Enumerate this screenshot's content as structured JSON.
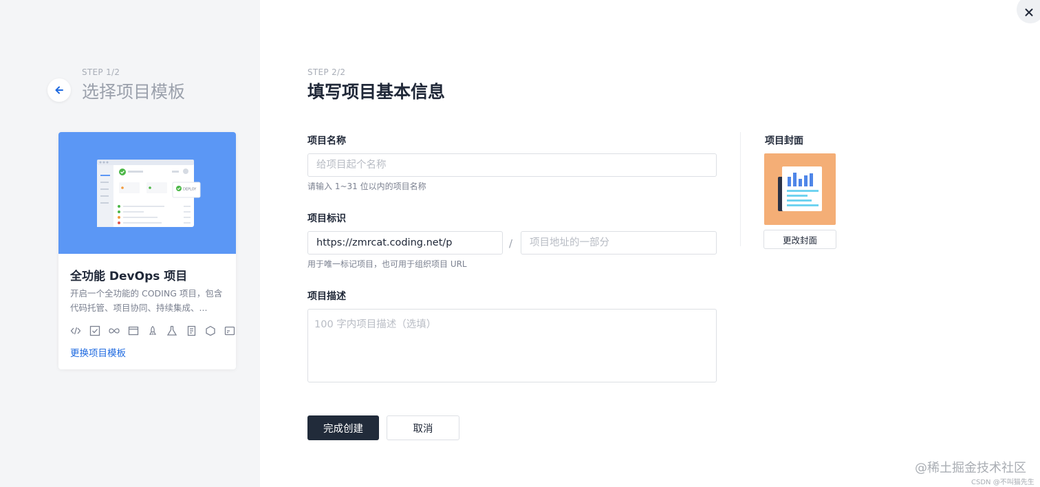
{
  "left_panel": {
    "step": "STEP 1/2",
    "title": "选择项目模板",
    "template": {
      "title": "全功能 DevOps 项目",
      "description": "开启一个全功能的 CODING 项目，包含代码托管、项目协同、持续集成、...",
      "preview_badge": "DEPLOY",
      "icons": [
        "code-icon",
        "task-check-icon",
        "infinity-icon",
        "window-icon",
        "rocket-icon",
        "flask-icon",
        "document-icon",
        "cube-icon",
        "api-icon"
      ],
      "change_link": "更换项目模板"
    }
  },
  "form": {
    "step": "STEP 2/2",
    "title": "填写项目基本信息",
    "name": {
      "label": "项目名称",
      "placeholder": "给项目起个名称",
      "hint": "请输入 1~31 位以内的项目名称"
    },
    "identifier": {
      "label": "项目标识",
      "prefix_value": "https://zmrcat.coding.net/p",
      "separator": "/",
      "placeholder": "项目地址的一部分",
      "hint": "用于唯一标记项目，也可用于组织项目 URL"
    },
    "description": {
      "label": "项目描述",
      "placeholder": "100 字内项目描述（选填）"
    },
    "cover": {
      "label": "项目封面",
      "change_button": "更改封面"
    },
    "actions": {
      "submit": "完成创建",
      "cancel": "取消"
    }
  },
  "watermark": {
    "site": "@稀土掘金技术社区",
    "author": "CSDN @不叫猫先生"
  },
  "colors": {
    "primary_button": "#212b3a",
    "link": "#1f6ae0",
    "template_hero": "#5b97f5",
    "cover_bg": "#f4ae76"
  }
}
